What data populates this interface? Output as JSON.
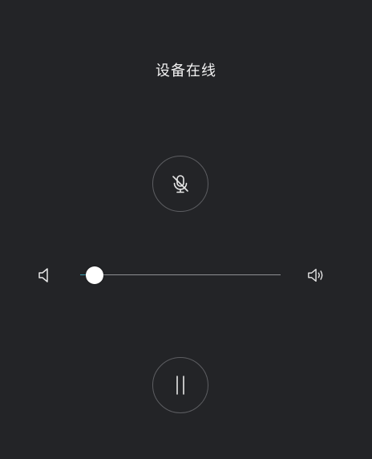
{
  "status": {
    "title": "设备在线"
  },
  "controls": {
    "mic_icon": "mic-off-icon",
    "pause_icon": "pause-icon",
    "volume_low_icon": "volume-low-icon",
    "volume_high_icon": "volume-high-icon"
  },
  "volume": {
    "level": 0.07
  },
  "colors": {
    "background": "#232427",
    "text": "#f2f2f2",
    "slider_fill": "#3a9fb0"
  }
}
